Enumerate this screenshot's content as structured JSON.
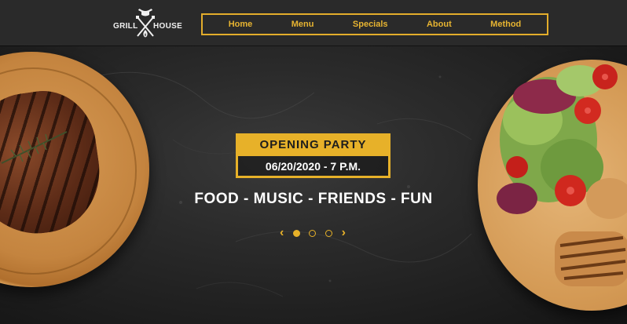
{
  "logo": {
    "left_text": "GRILL",
    "right_text": "HOUSE",
    "icon": "grill-logo-icon"
  },
  "nav": {
    "items": [
      "Home",
      "Menu",
      "Specials",
      "About",
      "Method"
    ]
  },
  "hero": {
    "event_title": "OPENING PARTY",
    "event_date": "06/20/2020 - 7 P.M.",
    "tagline": "FOOD - MUSIC - FRIENDS - FUN"
  },
  "carousel": {
    "prev_symbol": "‹",
    "next_symbol": "›",
    "active_index": 0,
    "slide_count": 3
  },
  "colors": {
    "accent": "#e7b129",
    "header_bg": "#2a2a2a",
    "hero_bg": "#1c1c1c"
  }
}
